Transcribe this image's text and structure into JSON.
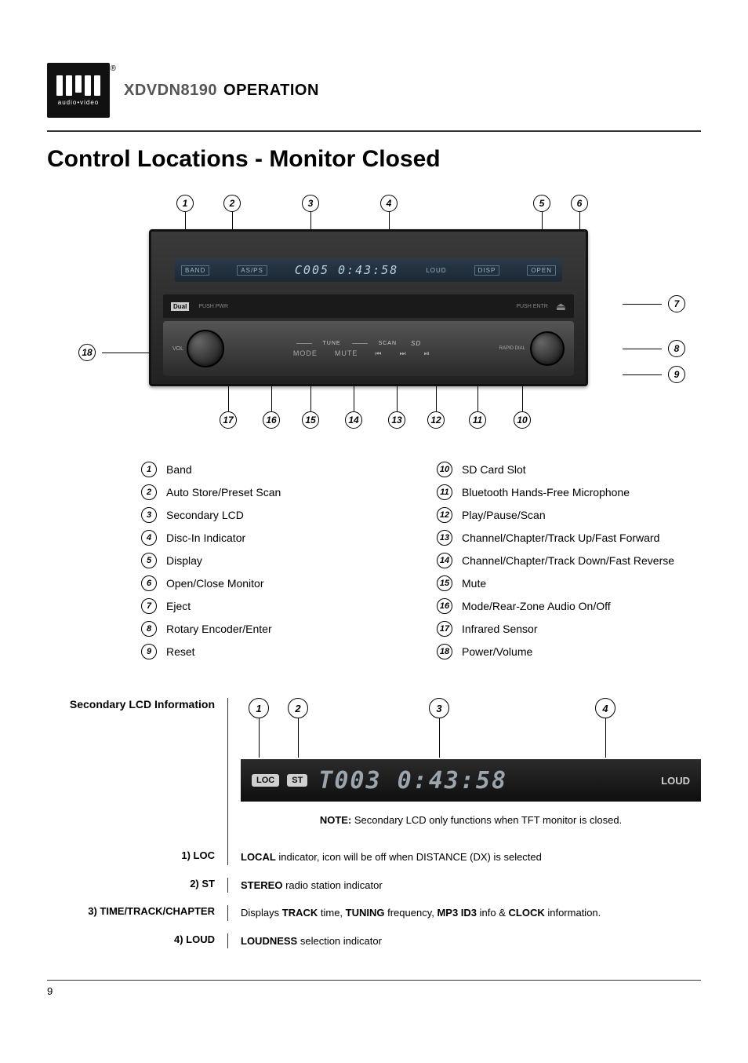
{
  "header": {
    "logo_text": "audio•video",
    "logo_reg": "®",
    "model": "XDVDN8190",
    "operation": "OPERATION"
  },
  "title": "Control Locations - Monitor Closed",
  "device_lcd": {
    "band": "BAND",
    "asps": "AS/PS",
    "readout": "C005  0:43:58",
    "loud": "LOUD",
    "disp": "DISP",
    "open": "OPEN",
    "dual": "Dual",
    "pushpwr": "PUSH PWR",
    "pushentr": "PUSH ENTR",
    "eject": "⏏",
    "vol": "VOL",
    "tune": "TUNE",
    "scan": "SCAN",
    "sd": "SD",
    "rapid": "RAPID DIAL",
    "mode": "MODE",
    "mute": "MUTE",
    "prev": "⏮",
    "next": "⏭",
    "play": "⏯"
  },
  "callouts_top": [
    "1",
    "2",
    "3",
    "4",
    "5",
    "6"
  ],
  "callouts_right": [
    "7",
    "8",
    "9"
  ],
  "callouts_left": [
    "18"
  ],
  "callouts_bottom": [
    "17",
    "16",
    "15",
    "14",
    "13",
    "12",
    "11",
    "10"
  ],
  "legend_left": [
    {
      "n": "1",
      "t": "Band"
    },
    {
      "n": "2",
      "t": "Auto Store/Preset Scan"
    },
    {
      "n": "3",
      "t": "Secondary LCD"
    },
    {
      "n": "4",
      "t": "Disc-In Indicator"
    },
    {
      "n": "5",
      "t": "Display"
    },
    {
      "n": "6",
      "t": "Open/Close Monitor"
    },
    {
      "n": "7",
      "t": "Eject"
    },
    {
      "n": "8",
      "t": "Rotary Encoder/Enter"
    },
    {
      "n": "9",
      "t": "Reset"
    }
  ],
  "legend_right": [
    {
      "n": "10",
      "t": "SD Card Slot"
    },
    {
      "n": "11",
      "t": "Bluetooth Hands-Free Microphone"
    },
    {
      "n": "12",
      "t": "Play/Pause/Scan"
    },
    {
      "n": "13",
      "t": "Channel/Chapter/Track Up/Fast Forward"
    },
    {
      "n": "14",
      "t": "Channel/Chapter/Track Down/Fast Reverse"
    },
    {
      "n": "15",
      "t": "Mute"
    },
    {
      "n": "16",
      "t": "Mode/Rear-Zone Audio On/Off"
    },
    {
      "n": "17",
      "t": "Infrared Sensor"
    },
    {
      "n": "18",
      "t": "Power/Volume"
    }
  ],
  "secondary": {
    "heading": "Secondary LCD Information",
    "callouts": [
      "1",
      "2",
      "3",
      "4"
    ],
    "loc": "LOC",
    "st": "ST",
    "readout": "T003  0:43:58",
    "loud": "LOUD",
    "note_label": "NOTE:",
    "note_text": " Secondary LCD only functions when TFT monitor is closed.",
    "rows": [
      {
        "left": "1) LOC",
        "b": "LOCAL",
        "rest": " indicator, icon will be off when DISTANCE (DX) is selected"
      },
      {
        "left": "2) ST",
        "b": "STEREO",
        "rest": " radio station indicator"
      },
      {
        "left": "3) TIME/TRACK/CHAPTER",
        "b": "",
        "rest": "Displays TRACK time, TUNING frequency, MP3 ID3 info & CLOCK information.",
        "rich": true
      },
      {
        "left": "4) LOUD",
        "b": "LOUDNESS",
        "rest": " selection indicator"
      }
    ]
  },
  "page_number": "9"
}
